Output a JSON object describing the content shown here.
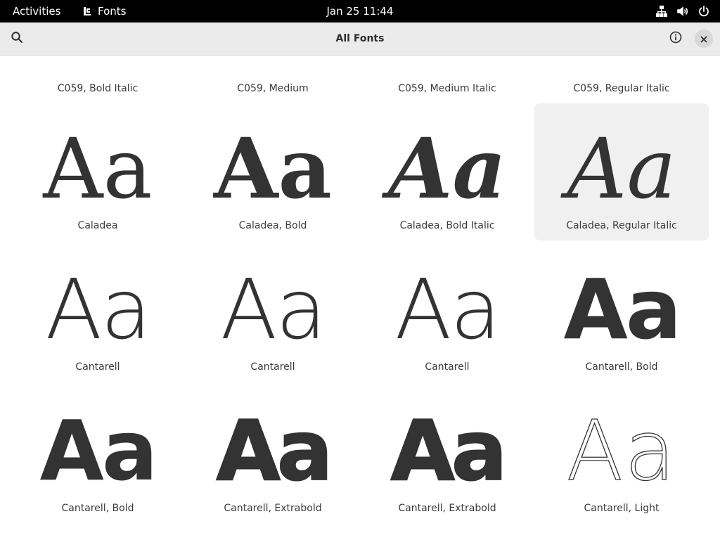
{
  "topbar": {
    "activities": "Activities",
    "app_name": "Fonts",
    "clock": "Jan 25  11:44",
    "tray_icons": [
      "network-icon",
      "volume-icon",
      "power-icon"
    ]
  },
  "header": {
    "title": "All Fonts",
    "search_icon": "search-icon",
    "info_icon": "info-icon",
    "close_icon": "close-icon"
  },
  "fonts": {
    "row0": [
      {
        "name": "C059, Bold Italic"
      },
      {
        "name": "C059, Medium"
      },
      {
        "name": "C059, Medium Italic"
      },
      {
        "name": "C059, Regular Italic"
      }
    ],
    "row1": [
      {
        "preview": "Aa",
        "name": "Caladea"
      },
      {
        "preview": "Aa",
        "name": "Caladea, Bold"
      },
      {
        "preview": "Aa",
        "name": "Caladea, Bold Italic"
      },
      {
        "preview": "Aa",
        "name": "Caladea, Regular Italic"
      }
    ],
    "row2": [
      {
        "preview": "Aa",
        "name": "Cantarell"
      },
      {
        "preview": "Aa",
        "name": "Cantarell"
      },
      {
        "preview": "Aa",
        "name": "Cantarell"
      },
      {
        "preview": "Aa",
        "name": "Cantarell, Bold"
      }
    ],
    "row3": [
      {
        "preview": "Aa",
        "name": "Cantarell, Bold"
      },
      {
        "preview": "Aa",
        "name": "Cantarell, Extrabold"
      },
      {
        "preview": "Aa",
        "name": "Cantarell, Extrabold"
      },
      {
        "preview": "Aa",
        "name": "Cantarell, Light"
      }
    ]
  },
  "colors": {
    "topbar_bg": "#000000",
    "headerbar_bg": "#ebebeb",
    "selected_tile_bg": "#f0f0f0",
    "preview_text": "#333333"
  }
}
